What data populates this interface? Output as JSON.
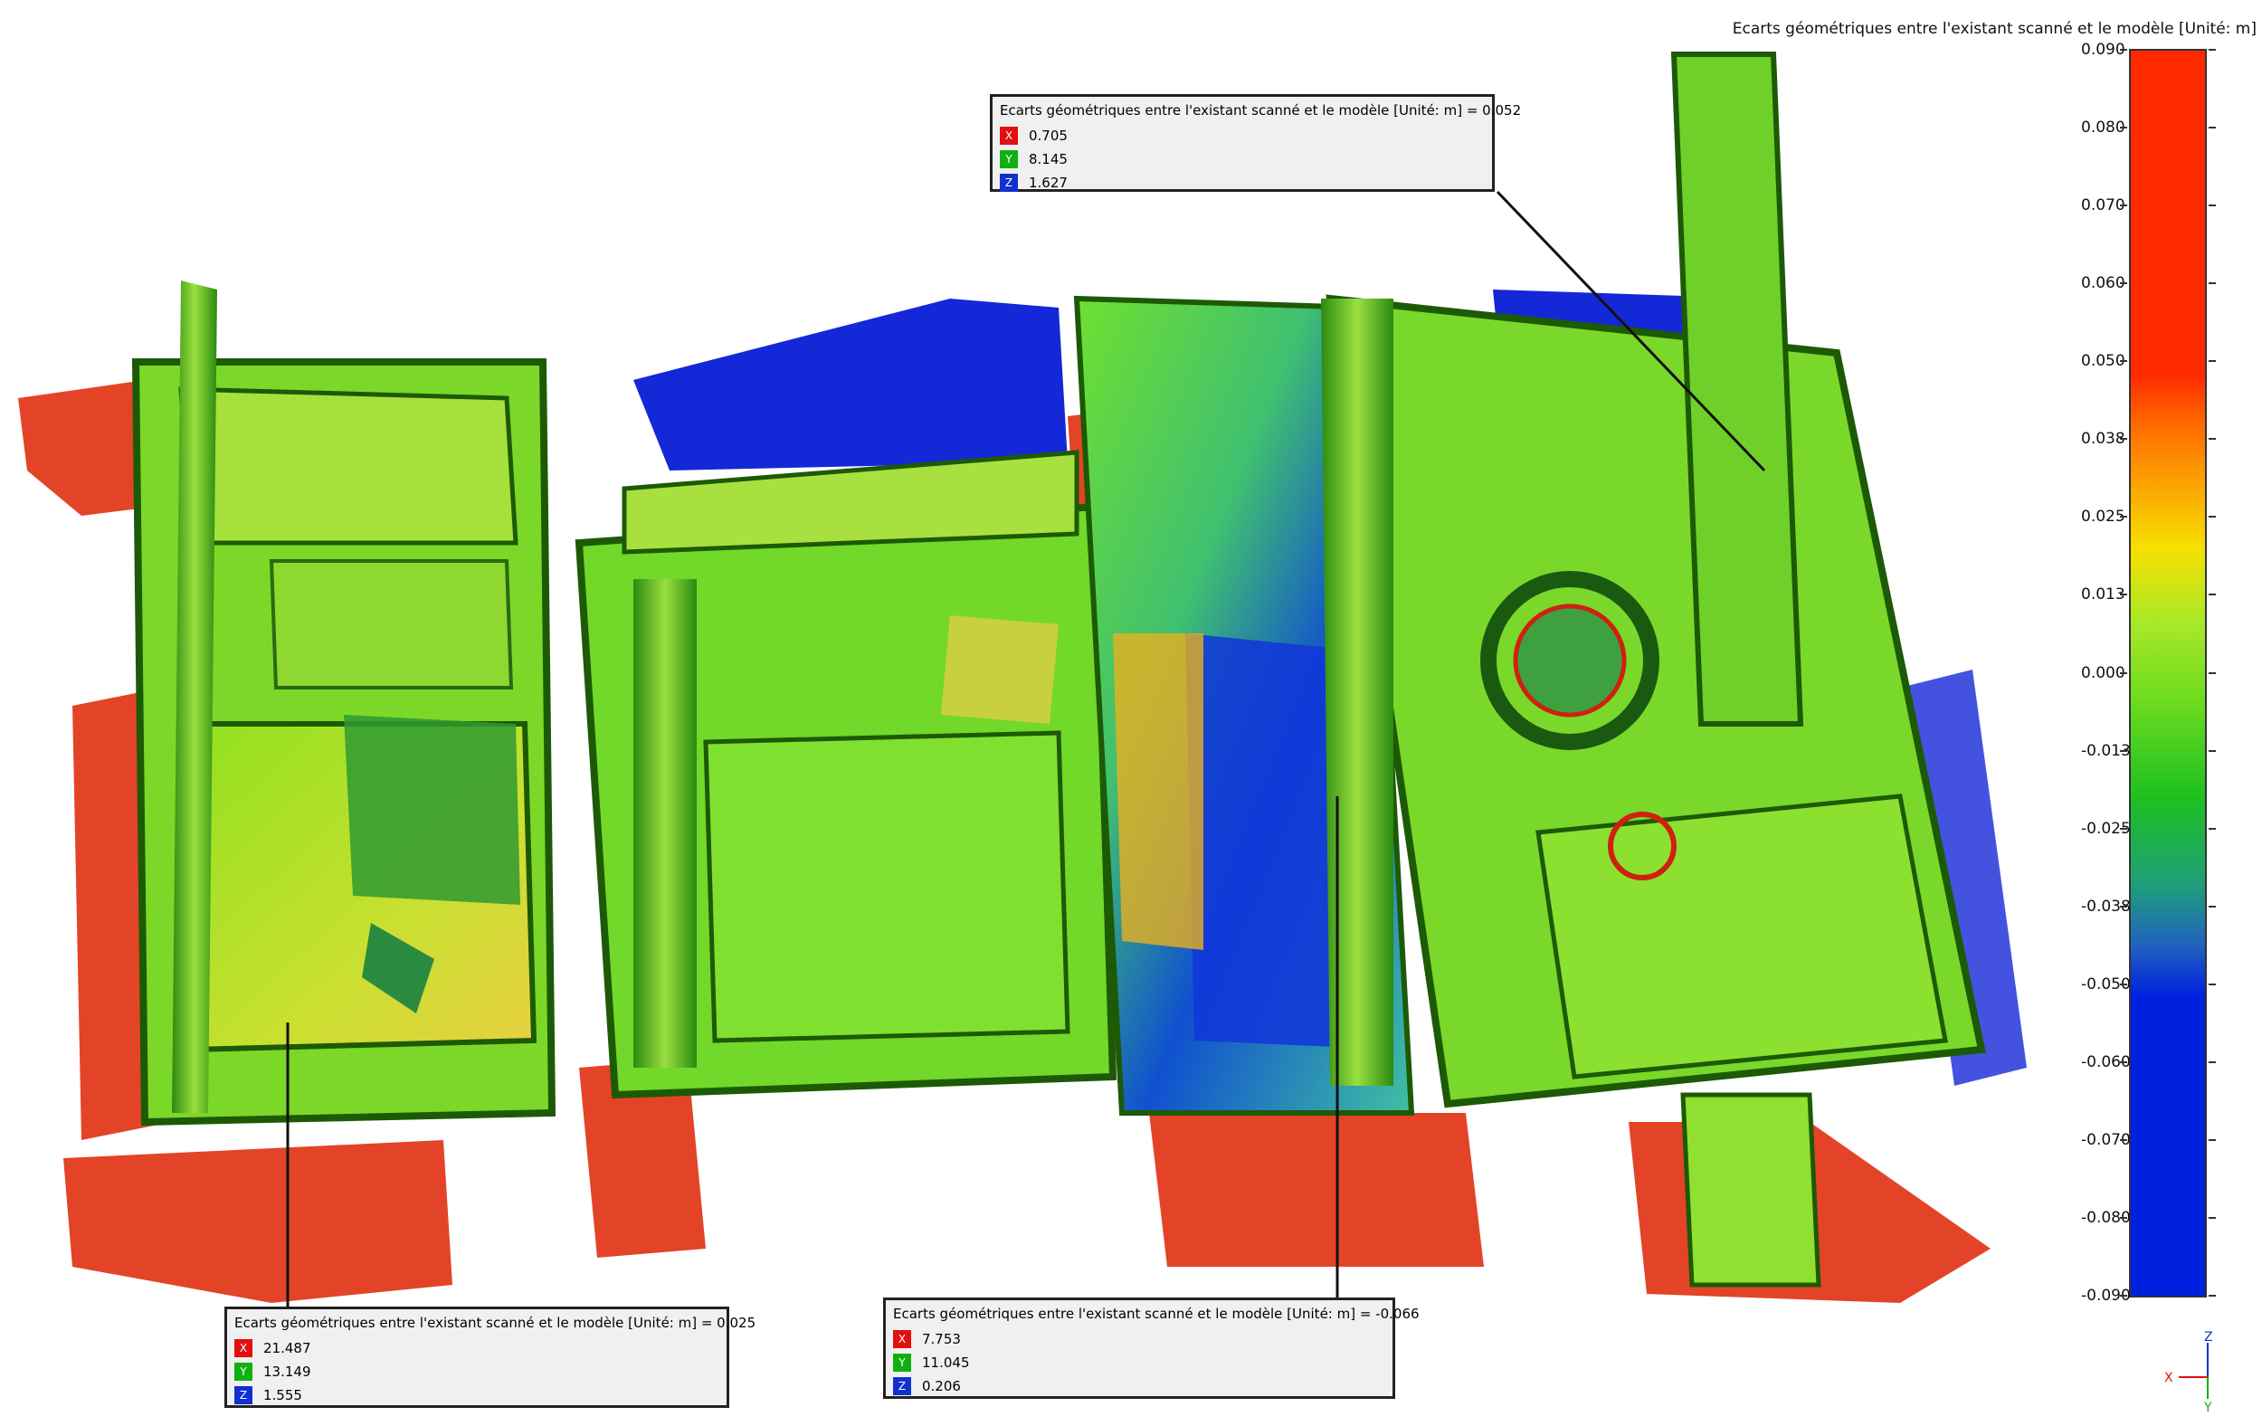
{
  "scale": {
    "title": "Ecarts géométriques entre l'existant scanné et le modèle [Unité: m]",
    "ticks": [
      "0.090",
      "0.080",
      "0.070",
      "0.060",
      "0.050",
      "0.038",
      "0.025",
      "0.013",
      "0.000",
      "-0.013",
      "-0.025",
      "-0.038",
      "-0.050",
      "-0.060",
      "-0.070",
      "-0.080",
      "-0.090"
    ],
    "colors": {
      "high": "#ff2a00",
      "mid_high": "#f7e000",
      "zero": "#6fdc1f",
      "mid_low": "#1f9f7a",
      "low": "#0020e0"
    }
  },
  "annotations": [
    {
      "title": "Ecarts géométriques entre l'existant scanné et le modèle [Unité: m] = 0.052",
      "x_label": "X",
      "x": "0.705",
      "y_label": "Y",
      "y": "8.145",
      "z_label": "Z",
      "z": "1.627"
    },
    {
      "title": "Ecarts géométriques entre l'existant scanné et le modèle [Unité: m] = 0.025",
      "x_label": "X",
      "x": "21.487",
      "y_label": "Y",
      "y": "13.149",
      "z_label": "Z",
      "z": "1.555"
    },
    {
      "title": "Ecarts géométriques entre l'existant scanné et le modèle [Unité: m] = -0.066",
      "x_label": "X",
      "x": "7.753",
      "y_label": "Y",
      "y": "11.045",
      "z_label": "Z",
      "z": "0.206"
    }
  ],
  "triad": {
    "x": "X",
    "y": "Y",
    "z": "Z"
  },
  "colors": {
    "x_axis": "#e01010",
    "y_axis": "#10b010",
    "z_axis": "#1030d0"
  }
}
